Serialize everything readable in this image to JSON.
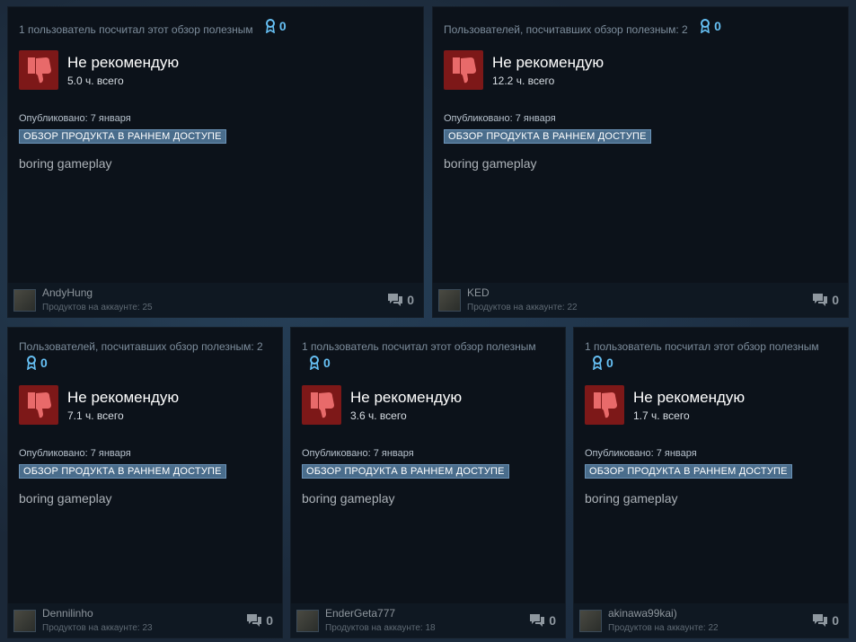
{
  "colors": {
    "accent": "#66c0f4",
    "thumb_bg": "#7d1818",
    "badge_bg": "#4a6d8c"
  },
  "reviews": [
    {
      "helpful_text": "1 пользователь посчитал этот обзор полезным",
      "awards": "0",
      "verdict": "Не рекомендую",
      "hours": "5.0 ч. всего",
      "posted": "Опубликовано: 7 января",
      "badge": "ОБЗОР ПРОДУКТА В РАННЕМ ДОСТУПЕ",
      "text": "boring gameplay",
      "user": "AndyHung",
      "products": "Продуктов на аккаунте: 25",
      "comments": "0",
      "icon": "thumbs-down-icon"
    },
    {
      "helpful_text": "Пользователей, посчитавших обзор полезным: 2",
      "awards": "0",
      "verdict": "Не рекомендую",
      "hours": "12.2 ч. всего",
      "posted": "Опубликовано: 7 января",
      "badge": "ОБЗОР ПРОДУКТА В РАННЕМ ДОСТУПЕ",
      "text": "boring gameplay",
      "user": "KED",
      "products": "Продуктов на аккаунте: 22",
      "comments": "0",
      "icon": "thumbs-down-icon"
    },
    {
      "helpful_text": "Пользователей, посчитавших обзор полезным: 2",
      "awards": "0",
      "verdict": "Не рекомендую",
      "hours": "7.1 ч. всего",
      "posted": "Опубликовано: 7 января",
      "badge": "ОБЗОР ПРОДУКТА В РАННЕМ ДОСТУПЕ",
      "text": "boring gameplay",
      "user": "Dennilinho",
      "products": "Продуктов на аккаунте: 23",
      "comments": "0",
      "icon": "thumbs-down-icon"
    },
    {
      "helpful_text": "1 пользователь посчитал этот обзор полезным",
      "awards": "0",
      "verdict": "Не рекомендую",
      "hours": "3.6 ч. всего",
      "posted": "Опубликовано: 7 января",
      "badge": "ОБЗОР ПРОДУКТА В РАННЕМ ДОСТУПЕ",
      "text": "boring gameplay",
      "user": "EnderGeta777",
      "products": "Продуктов на аккаунте: 18",
      "comments": "0",
      "icon": "thumbs-down-icon"
    },
    {
      "helpful_text": "1 пользователь посчитал этот обзор полезным",
      "awards": "0",
      "verdict": "Не рекомендую",
      "hours": "1.7 ч. всего",
      "posted": "Опубликовано: 7 января",
      "badge": "ОБЗОР ПРОДУКТА В РАННЕМ ДОСТУПЕ",
      "text": "boring gameplay",
      "user": "akinawa99kai)",
      "products": "Продуктов на аккаунте: 22",
      "comments": "0",
      "icon": "thumbs-down-icon"
    }
  ]
}
